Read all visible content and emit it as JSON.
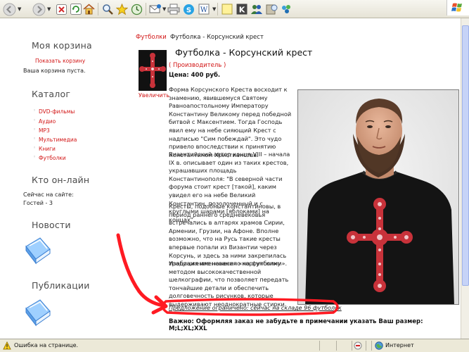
{
  "toolbar": {
    "icons": [
      "back-icon",
      "forward-icon",
      "stop-icon",
      "refresh-icon",
      "home-icon",
      "search-icon",
      "favorites-icon",
      "history-icon",
      "mail-icon",
      "print-icon",
      "skype-icon",
      "edit-icon",
      "note-icon",
      "k-icon",
      "messenger-icon",
      "research-icon"
    ]
  },
  "sidebar": {
    "cart_heading": "Моя корзина",
    "cart_link": "Показать корзину",
    "cart_empty": "Ваша корзина пуста.",
    "catalog_heading": "Каталог",
    "catalog_items": [
      "DVD-фильмы",
      "Аудио",
      "MP3",
      "Мультимедиа",
      "Книги",
      "Футболки"
    ],
    "online_heading": "Кто он-лайн",
    "online_now": "Сейчас на сайте:",
    "online_guests": "Гостей - 3",
    "news_heading": "Новости",
    "publications_heading": "Публикации"
  },
  "breadcrumb": {
    "category": "Футболки",
    "current": "Футболка - Корсунский крест"
  },
  "product": {
    "title": "Футболка - Корсунский крест",
    "zoom_label": "Увеличить",
    "manufacturer": "( Производитель )",
    "price": "Цена: 400 руб.",
    "description": [
      "Форма Корсунского Креста восходит к знамению, явившемуся Святому Равноапостольному Императору Константину Великому перед победной битвой с Максентием. Тогда Господь явил ему на небе сияющий Крест с надписью \"Сим побеждай\". Это чудо привело впоследствии к принятию Константином Христианства.",
      "Византийский автор конца VIII – начала IX в. описывает один из таких крестов, украшавших площадь Константинополя: \"В северной части форума стоит крест [такой], каким увидел его на небе Великий Константин, позолоченный и с круглыми шарами [яблоками] на концах\".",
      "Кресты, подобные константиновы, в период раннего средневековья встречались в алтарях храмов Сирии, Армении, Грузии, на Афоне. Вполне возможно, что на Русь такие кресты впервые попали из Византии через Корсунь, и здесь за ними закрепилась традиция именования «корсунскими».",
      "Изображение нанесено на футболку методом высококачественной шелкографии, что позволяет передать тончайшие детали и обеспечить долговечность рисунков, которые выдерживают неоднократные стирки."
    ],
    "offer": "Предложение ограничено: сейчас на складе 96 футболок",
    "notice": "Важно: Оформляя заказ не забудьте в примечании указать Ваш размер: M;L;XL;XXL"
  },
  "statusbar": {
    "message": "Ошибка на странице.",
    "zone": "Интернет"
  },
  "colors": {
    "link": "#d21414",
    "annotation": "#ff1a22",
    "shirt": "#151515",
    "cross": "#c8323a"
  }
}
